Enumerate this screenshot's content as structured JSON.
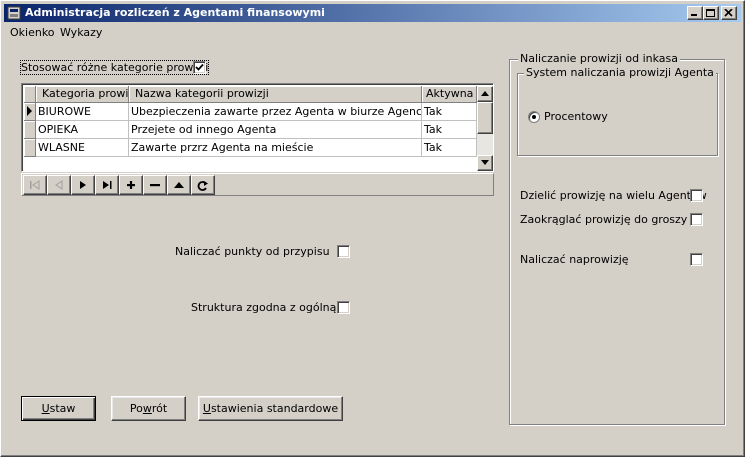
{
  "window": {
    "title": "Administracja rozliczeń z Agentami finansowymi"
  },
  "menu": [
    {
      "label": "Okienko"
    },
    {
      "label": "Wykazy"
    }
  ],
  "left": {
    "categories_checkbox": {
      "label": "Stosować różne kategorie prowizji",
      "checked": true
    },
    "grid": {
      "columns": [
        "Kategoria prowizji",
        "Nazwa kategorii prowizji",
        "Aktywna"
      ],
      "rows": [
        {
          "code": "BIUROWE",
          "name": "Ubezpieczenia zawarte przez Agenta w biurze Agencji",
          "active": "Tak"
        },
        {
          "code": "OPIEKA",
          "name": "Przejete od innego Agenta",
          "active": "Tak"
        },
        {
          "code": "WLASNE",
          "name": "Zawarte przrz Agenta na mieście",
          "active": "Tak"
        }
      ]
    },
    "points_checkbox": {
      "label": "Naliczać punkty od przypisu",
      "checked": false
    },
    "structure_checkbox": {
      "label": "Struktura zgodna z ogólną",
      "checked": false
    }
  },
  "right": {
    "group_title": "Naliczanie prowizji od inkasa",
    "system_group_title": "System naliczania prowizji Agenta",
    "radio_label": "Procentowy",
    "split_checkbox": {
      "label": "Dzielić prowizję na wielu Agentów",
      "checked": false
    },
    "round_checkbox": {
      "label": "Zaokrąglać prowizję do groszy",
      "checked": false
    },
    "overcommission_checkbox": {
      "label": "Naliczać naprowizję",
      "checked": false
    }
  },
  "buttons": {
    "set": {
      "accel": "U",
      "rest": "staw"
    },
    "back": {
      "pre": "Po",
      "accel": "w",
      "rest": "rót"
    },
    "defaults": {
      "accel": "U",
      "rest": "stawienia standardowe"
    }
  },
  "colors": {
    "face": "#d4d0c8",
    "title_start": "#0a246a",
    "title_end": "#a6caf0"
  }
}
